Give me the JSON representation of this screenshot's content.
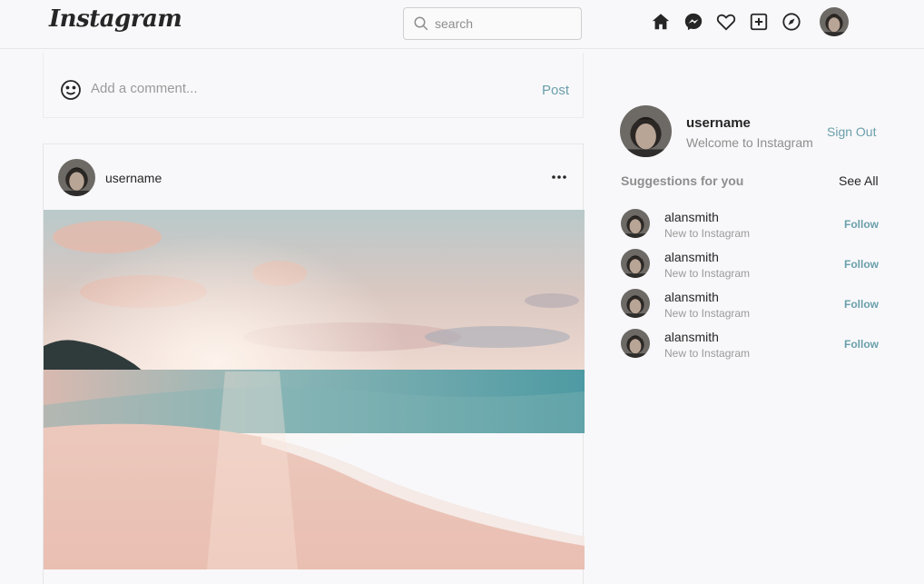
{
  "header": {
    "logo": "Instagram",
    "search": {
      "placeholder": "search",
      "value": ""
    },
    "nav_icons": [
      "home-icon",
      "messenger-icon",
      "heart-icon",
      "add-post-icon",
      "explore-icon"
    ]
  },
  "comment_box": {
    "placeholder": "Add a comment...",
    "post_label": "Post"
  },
  "post": {
    "username": "username",
    "more_icon": "more-horizontal-icon",
    "image": "beach-sunset-photo"
  },
  "sidebar": {
    "profile": {
      "username": "username",
      "subtitle": "Welcome to Instagram",
      "sign_out_label": "Sign Out"
    },
    "suggestions_title": "Suggestions for you",
    "see_all_label": "See All",
    "suggestions": [
      {
        "name": "alansmith",
        "sub": "New to Instagram",
        "follow": "Follow"
      },
      {
        "name": "alansmith",
        "sub": "New to Instagram",
        "follow": "Follow"
      },
      {
        "name": "alansmith",
        "sub": "New to Instagram",
        "follow": "Follow"
      },
      {
        "name": "alansmith",
        "sub": "New to Instagram",
        "follow": "Follow"
      }
    ]
  },
  "colors": {
    "accent": "#6a9fab",
    "muted_text": "#8e8e8e",
    "background": "#f8f8fa"
  }
}
